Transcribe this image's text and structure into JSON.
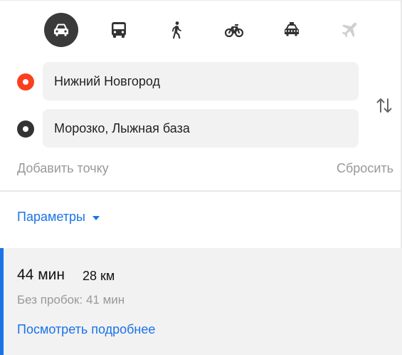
{
  "transport_modes": [
    {
      "name": "car",
      "icon": "car-icon",
      "active": true
    },
    {
      "name": "bus",
      "icon": "bus-icon",
      "active": false
    },
    {
      "name": "walk",
      "icon": "walk-icon",
      "active": false
    },
    {
      "name": "bike",
      "icon": "bike-icon",
      "active": false
    },
    {
      "name": "taxi",
      "icon": "taxi-icon",
      "active": false
    },
    {
      "name": "plane",
      "icon": "plane-icon",
      "active": false,
      "disabled": true
    }
  ],
  "route": {
    "from": "Нижний Новгород",
    "to": "Морозко, Лыжная база"
  },
  "actions": {
    "add_point": "Добавить точку",
    "reset": "Сбросить"
  },
  "params": {
    "label": "Параметры"
  },
  "result": {
    "time": "44 мин",
    "distance": "28 км",
    "no_traffic": "Без пробок: 41 мин",
    "details_link": "Посмотреть подробнее"
  },
  "colors": {
    "accent": "#1a73e8",
    "start_dot": "#fc3f1d",
    "end_dot": "#333333",
    "active_mode_bg": "#3a3a3a"
  }
}
